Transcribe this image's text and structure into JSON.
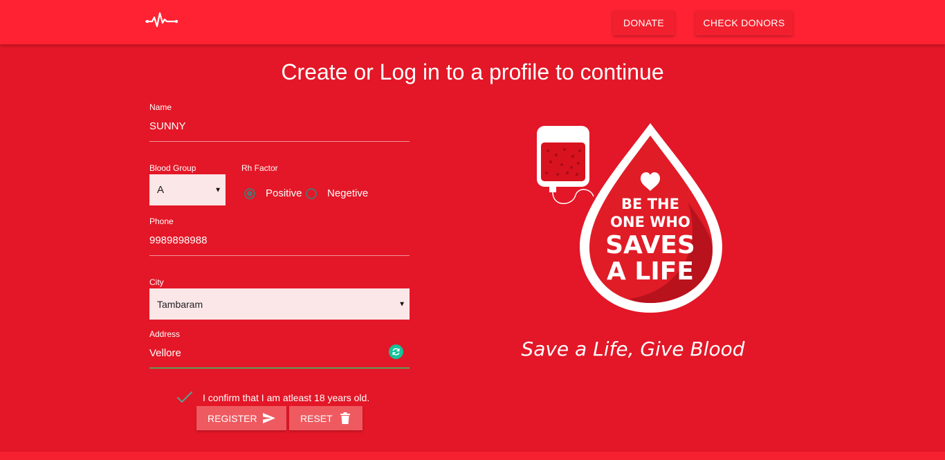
{
  "nav": {
    "logo_icon": "heartbeat-pulse-icon",
    "donate_label": "DONATE",
    "check_donors_label": "CHECK DONORS"
  },
  "page": {
    "title": "Create or Log in to a profile to continue"
  },
  "form": {
    "name": {
      "label": "Name",
      "value": "SUNNY"
    },
    "blood_group": {
      "label": "Blood Group",
      "value": "A"
    },
    "rh_factor": {
      "label": "Rh Factor",
      "options": [
        {
          "label": "Positive",
          "checked": true
        },
        {
          "label": "Negetive",
          "checked": false
        }
      ]
    },
    "phone": {
      "label": "Phone",
      "value": "9989898988"
    },
    "city": {
      "label": "City",
      "value": "Tambaram"
    },
    "address": {
      "label": "Address",
      "value": "Vellore"
    },
    "confirm": {
      "label": "I confirm that I am atleast 18 years old.",
      "checked": true
    },
    "register_label": "REGISTER",
    "reset_label": "RESET"
  },
  "hero": {
    "badge_lines": [
      "BE THE",
      "ONE WHO",
      "SAVES",
      "A LIFE"
    ],
    "tagline": "Save a Life, Give Blood"
  },
  "colors": {
    "background": "#e31727",
    "navbar": "#ff2233",
    "button": "#ee5a60",
    "input_fill": "#fbe6e8",
    "active_underline": "#5a9e5a",
    "radio": "#5a6f6c",
    "grammarly": "#15c39a"
  }
}
